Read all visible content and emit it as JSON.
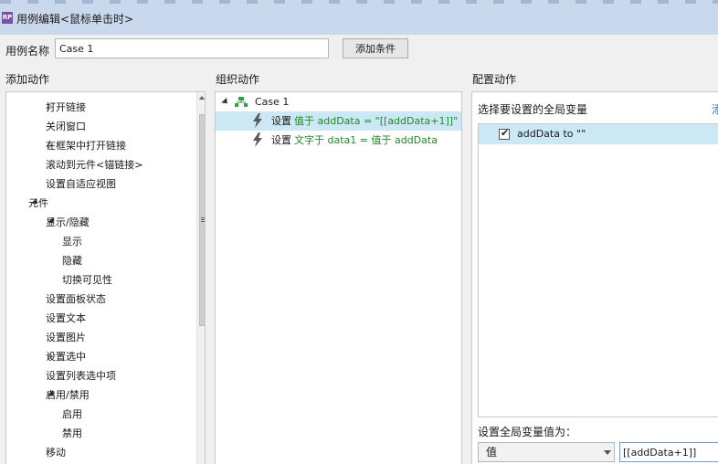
{
  "window": {
    "title": "用例编辑<鼠标单击时>",
    "icon": "RP"
  },
  "case_name": {
    "label": "用例名称",
    "value": "Case 1",
    "add_condition_label": "添加条件"
  },
  "sections": {
    "add_actions": "添加动作",
    "organize_actions": "组织动作",
    "configure_actions": "配置动作"
  },
  "add_actions_tree": [
    {
      "label": "打开链接",
      "indent": 1,
      "toggle": "collapsed"
    },
    {
      "label": "关闭窗口",
      "indent": 1,
      "toggle": "none"
    },
    {
      "label": "在框架中打开链接",
      "indent": 1,
      "toggle": "collapsed"
    },
    {
      "label": "滚动到元件<锚链接>",
      "indent": 1,
      "toggle": "none"
    },
    {
      "label": "设置自适应视图",
      "indent": 1,
      "toggle": "none"
    },
    {
      "label": "元件",
      "indent": 0,
      "toggle": "expanded"
    },
    {
      "label": "显示/隐藏",
      "indent": 1,
      "toggle": "expanded"
    },
    {
      "label": "显示",
      "indent": 2,
      "toggle": "none"
    },
    {
      "label": "隐藏",
      "indent": 2,
      "toggle": "none"
    },
    {
      "label": "切换可见性",
      "indent": 2,
      "toggle": "none"
    },
    {
      "label": "设置面板状态",
      "indent": 1,
      "toggle": "none"
    },
    {
      "label": "设置文本",
      "indent": 1,
      "toggle": "none"
    },
    {
      "label": "设置图片",
      "indent": 1,
      "toggle": "none"
    },
    {
      "label": "设置选中",
      "indent": 1,
      "toggle": "collapsed"
    },
    {
      "label": "设置列表选中项",
      "indent": 1,
      "toggle": "none"
    },
    {
      "label": "启用/禁用",
      "indent": 1,
      "toggle": "expanded"
    },
    {
      "label": "启用",
      "indent": 2,
      "toggle": "none"
    },
    {
      "label": "禁用",
      "indent": 2,
      "toggle": "none"
    },
    {
      "label": "移动",
      "indent": 1,
      "toggle": "none"
    }
  ],
  "organize": {
    "case_label": "Case 1",
    "actions": [
      {
        "verb": "设置",
        "detail": "值于 addData = \"[[addData+1]]\"",
        "selected": true
      },
      {
        "verb": "设置",
        "detail": "文字于 data1 = 值于 addData",
        "selected": false
      }
    ]
  },
  "configure": {
    "heading": "选择要设置的全局变量",
    "link_text": "添",
    "variables": [
      {
        "label": "addData to \"\"",
        "checked": true
      }
    ],
    "set_value_label": "设置全局变量值为：",
    "value_type": "值",
    "value_text": "[[addData+1]]"
  },
  "colors": {
    "selection": "#cce8f4",
    "action_text": "#22882b",
    "link": "#2a7ac0",
    "app_icon": "#7a4fa8"
  }
}
